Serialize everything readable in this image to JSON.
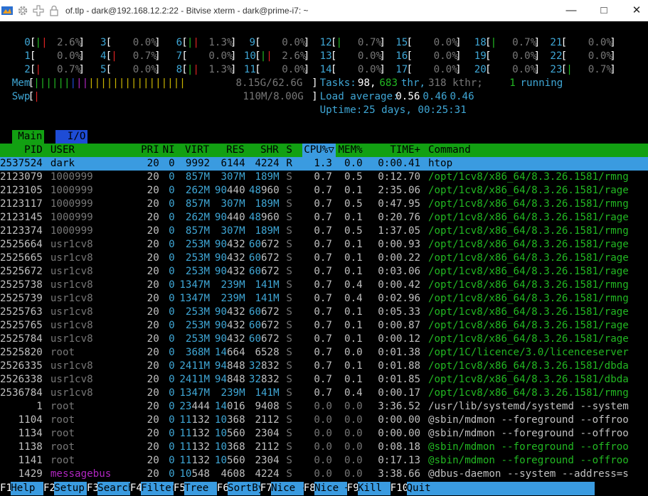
{
  "window": {
    "title": "of.tlp - dark@192.168.12.2:22 - Bitvise xterm - dark@prime-i7: ~",
    "icons": [
      "bitvise-logo-icon",
      "gear-icon",
      "plus-move-icon",
      "lock-icon"
    ],
    "controls": [
      "minimize",
      "maximize",
      "close"
    ]
  },
  "cpu_meters": [
    {
      "n": "0",
      "v": "2.6%"
    },
    {
      "n": "1",
      "v": "0.0%"
    },
    {
      "n": "2",
      "v": "0.7%"
    },
    {
      "n": "3",
      "v": "0.0%"
    },
    {
      "n": "4",
      "v": "0.7%"
    },
    {
      "n": "5",
      "v": "0.0%"
    },
    {
      "n": "6",
      "v": "1.3%"
    },
    {
      "n": "7",
      "v": "0.0%"
    },
    {
      "n": "8",
      "v": "1.3%"
    },
    {
      "n": "9",
      "v": "0.0%"
    },
    {
      "n": "10",
      "v": "2.6%"
    },
    {
      "n": "11",
      "v": "0.0%"
    },
    {
      "n": "12",
      "v": "0.7%"
    },
    {
      "n": "13",
      "v": "0.0%"
    },
    {
      "n": "14",
      "v": "0.0%"
    },
    {
      "n": "15",
      "v": "0.0%"
    },
    {
      "n": "16",
      "v": "0.0%"
    },
    {
      "n": "17",
      "v": "0.0%"
    },
    {
      "n": "18",
      "v": "0.7%"
    },
    {
      "n": "19",
      "v": "0.0%"
    },
    {
      "n": "20",
      "v": "0.0%"
    },
    {
      "n": "21",
      "v": "0.0%"
    },
    {
      "n": "22",
      "v": "0.0%"
    },
    {
      "n": "23",
      "v": "0.7%"
    }
  ],
  "mem": {
    "label": "Mem",
    "value": "8.15G/62.6G"
  },
  "swp": {
    "label": "Swp",
    "value": "110M/8.00G"
  },
  "tasks": {
    "label": "Tasks:",
    "tasks": "98,",
    "thr": "683",
    "thr_label": "thr,",
    "kthr": "318 kthr;",
    "running": "1",
    "running_label": "running"
  },
  "load": {
    "label": "Load average:",
    "l1": "0.56",
    "l5": "0.46",
    "l15": "0.46"
  },
  "uptime": {
    "label": "Uptime:",
    "value": "25 days, 00:25:31"
  },
  "tabs": {
    "main": "Main",
    "io": "I/O"
  },
  "columns": {
    "pid": "PID",
    "user": "USER",
    "pri": "PRI",
    "ni": "NI",
    "virt": "VIRT",
    "res": "RES",
    "shr": "SHR",
    "s": "S",
    "cpu": "CPU%▽",
    "mem": "MEM%",
    "time": "TIME+",
    "cmd": "Command"
  },
  "processes": [
    {
      "pid": "2537524",
      "user": "dark",
      "pri": "20",
      "ni": "0",
      "virt": "9992",
      "res": "6144",
      "shr": "4224",
      "s": "R",
      "cpu": "1.3",
      "mem": "0.0",
      "time": "0:00.41",
      "cmd": "htop"
    },
    {
      "pid": "2123079",
      "user": "1000999",
      "pri": "20",
      "ni": "0",
      "virt": "857M",
      "res": "307M",
      "shr": "189M",
      "s": "S",
      "cpu": "0.7",
      "mem": "0.5",
      "time": "0:12.70",
      "cmd": "/opt/1cv8/x86_64/8.3.26.1581/rmng"
    },
    {
      "pid": "2123105",
      "user": "1000999",
      "pri": "20",
      "ni": "0",
      "virt": "262M",
      "res": "90440",
      "shr": "48960",
      "s": "S",
      "cpu": "0.7",
      "mem": "0.1",
      "time": "2:35.06",
      "cmd": "/opt/1cv8/x86_64/8.3.26.1581/rage"
    },
    {
      "pid": "2123117",
      "user": "1000999",
      "pri": "20",
      "ni": "0",
      "virt": "857M",
      "res": "307M",
      "shr": "189M",
      "s": "S",
      "cpu": "0.7",
      "mem": "0.5",
      "time": "0:47.95",
      "cmd": "/opt/1cv8/x86_64/8.3.26.1581/rmng"
    },
    {
      "pid": "2123145",
      "user": "1000999",
      "pri": "20",
      "ni": "0",
      "virt": "262M",
      "res": "90440",
      "shr": "48960",
      "s": "S",
      "cpu": "0.7",
      "mem": "0.1",
      "time": "0:20.76",
      "cmd": "/opt/1cv8/x86_64/8.3.26.1581/rage"
    },
    {
      "pid": "2123374",
      "user": "1000999",
      "pri": "20",
      "ni": "0",
      "virt": "857M",
      "res": "307M",
      "shr": "189M",
      "s": "S",
      "cpu": "0.7",
      "mem": "0.5",
      "time": "1:37.05",
      "cmd": "/opt/1cv8/x86_64/8.3.26.1581/rmng"
    },
    {
      "pid": "2525664",
      "user": "usr1cv8",
      "pri": "20",
      "ni": "0",
      "virt": "253M",
      "res": "90432",
      "shr": "60672",
      "s": "S",
      "cpu": "0.7",
      "mem": "0.1",
      "time": "0:00.93",
      "cmd": "/opt/1cv8/x86_64/8.3.26.1581/rage"
    },
    {
      "pid": "2525665",
      "user": "usr1cv8",
      "pri": "20",
      "ni": "0",
      "virt": "253M",
      "res": "90432",
      "shr": "60672",
      "s": "S",
      "cpu": "0.7",
      "mem": "0.1",
      "time": "0:00.22",
      "cmd": "/opt/1cv8/x86_64/8.3.26.1581/rage"
    },
    {
      "pid": "2525672",
      "user": "usr1cv8",
      "pri": "20",
      "ni": "0",
      "virt": "253M",
      "res": "90432",
      "shr": "60672",
      "s": "S",
      "cpu": "0.7",
      "mem": "0.1",
      "time": "0:03.06",
      "cmd": "/opt/1cv8/x86_64/8.3.26.1581/rage"
    },
    {
      "pid": "2525738",
      "user": "usr1cv8",
      "pri": "20",
      "ni": "0",
      "virt": "1347M",
      "res": "239M",
      "shr": "141M",
      "s": "S",
      "cpu": "0.7",
      "mem": "0.4",
      "time": "0:00.42",
      "cmd": "/opt/1cv8/x86_64/8.3.26.1581/rmng"
    },
    {
      "pid": "2525739",
      "user": "usr1cv8",
      "pri": "20",
      "ni": "0",
      "virt": "1347M",
      "res": "239M",
      "shr": "141M",
      "s": "S",
      "cpu": "0.7",
      "mem": "0.4",
      "time": "0:02.96",
      "cmd": "/opt/1cv8/x86_64/8.3.26.1581/rmng"
    },
    {
      "pid": "2525763",
      "user": "usr1cv8",
      "pri": "20",
      "ni": "0",
      "virt": "253M",
      "res": "90432",
      "shr": "60672",
      "s": "S",
      "cpu": "0.7",
      "mem": "0.1",
      "time": "0:05.33",
      "cmd": "/opt/1cv8/x86_64/8.3.26.1581/rage"
    },
    {
      "pid": "2525765",
      "user": "usr1cv8",
      "pri": "20",
      "ni": "0",
      "virt": "253M",
      "res": "90432",
      "shr": "60672",
      "s": "S",
      "cpu": "0.7",
      "mem": "0.1",
      "time": "0:00.87",
      "cmd": "/opt/1cv8/x86_64/8.3.26.1581/rage"
    },
    {
      "pid": "2525784",
      "user": "usr1cv8",
      "pri": "20",
      "ni": "0",
      "virt": "253M",
      "res": "90432",
      "shr": "60672",
      "s": "S",
      "cpu": "0.7",
      "mem": "0.1",
      "time": "0:00.12",
      "cmd": "/opt/1cv8/x86_64/8.3.26.1581/rage"
    },
    {
      "pid": "2525820",
      "user": "root",
      "pri": "20",
      "ni": "0",
      "virt": "368M",
      "res": "14664",
      "shr": "6528",
      "s": "S",
      "cpu": "0.7",
      "mem": "0.0",
      "time": "0:01.38",
      "cmd": "/opt/1C/licence/3.0/licenceserver"
    },
    {
      "pid": "2526335",
      "user": "usr1cv8",
      "pri": "20",
      "ni": "0",
      "virt": "2411M",
      "res": "94848",
      "shr": "32832",
      "s": "S",
      "cpu": "0.7",
      "mem": "0.1",
      "time": "0:01.88",
      "cmd": "/opt/1cv8/x86_64/8.3.26.1581/dbda"
    },
    {
      "pid": "2526338",
      "user": "usr1cv8",
      "pri": "20",
      "ni": "0",
      "virt": "2411M",
      "res": "94848",
      "shr": "32832",
      "s": "S",
      "cpu": "0.7",
      "mem": "0.1",
      "time": "0:01.85",
      "cmd": "/opt/1cv8/x86_64/8.3.26.1581/dbda"
    },
    {
      "pid": "2536784",
      "user": "usr1cv8",
      "pri": "20",
      "ni": "0",
      "virt": "1347M",
      "res": "239M",
      "shr": "141M",
      "s": "S",
      "cpu": "0.7",
      "mem": "0.4",
      "time": "0:00.17",
      "cmd": "/opt/1cv8/x86_64/8.3.26.1581/rmng"
    },
    {
      "pid": "1",
      "user": "root",
      "pri": "20",
      "ni": "0",
      "virt": "23444",
      "res": "14016",
      "shr": "9408",
      "s": "S",
      "cpu": "0.0",
      "mem": "0.0",
      "time": "3:36.52",
      "cmd": "/usr/lib/systemd/systemd --system"
    },
    {
      "pid": "1104",
      "user": "root",
      "pri": "20",
      "ni": "0",
      "virt": "11132",
      "res": "10368",
      "shr": "2112",
      "s": "S",
      "cpu": "0.0",
      "mem": "0.0",
      "time": "0:00.00",
      "cmd": "@sbin/mdmon --foreground --offroo"
    },
    {
      "pid": "1134",
      "user": "root",
      "pri": "20",
      "ni": "0",
      "virt": "11132",
      "res": "10560",
      "shr": "2304",
      "s": "S",
      "cpu": "0.0",
      "mem": "0.0",
      "time": "0:00.00",
      "cmd": "@sbin/mdmon --foreground --offroo"
    },
    {
      "pid": "1138",
      "user": "root",
      "pri": "20",
      "ni": "0",
      "virt": "11132",
      "res": "10368",
      "shr": "2112",
      "s": "S",
      "cpu": "0.0",
      "mem": "0.0",
      "time": "0:08.18",
      "cmd": "@sbin/mdmon --foreground --offroo"
    },
    {
      "pid": "1141",
      "user": "root",
      "pri": "20",
      "ni": "0",
      "virt": "11132",
      "res": "10560",
      "shr": "2304",
      "s": "S",
      "cpu": "0.0",
      "mem": "0.0",
      "time": "0:17.13",
      "cmd": "@sbin/mdmon --foreground --offroo"
    },
    {
      "pid": "1429",
      "user": "messagebus",
      "pri": "20",
      "ni": "0",
      "virt": "10548",
      "res": "4608",
      "shr": "4224",
      "s": "S",
      "cpu": "0.0",
      "mem": "0.0",
      "time": "3:38.66",
      "cmd": "@dbus-daemon --system --address=s"
    }
  ],
  "function_keys": [
    {
      "key": "F1",
      "label": "Help"
    },
    {
      "key": "F2",
      "label": "Setup"
    },
    {
      "key": "F3",
      "label": "Search"
    },
    {
      "key": "F4",
      "label": "Filter"
    },
    {
      "key": "F5",
      "label": "Tree"
    },
    {
      "key": "F6",
      "label": "SortBy"
    },
    {
      "key": "F7",
      "label": "Nice -"
    },
    {
      "key": "F8",
      "label": "Nice +"
    },
    {
      "key": "F9",
      "label": "Kill"
    },
    {
      "key": "F10",
      "label": "Quit"
    }
  ]
}
